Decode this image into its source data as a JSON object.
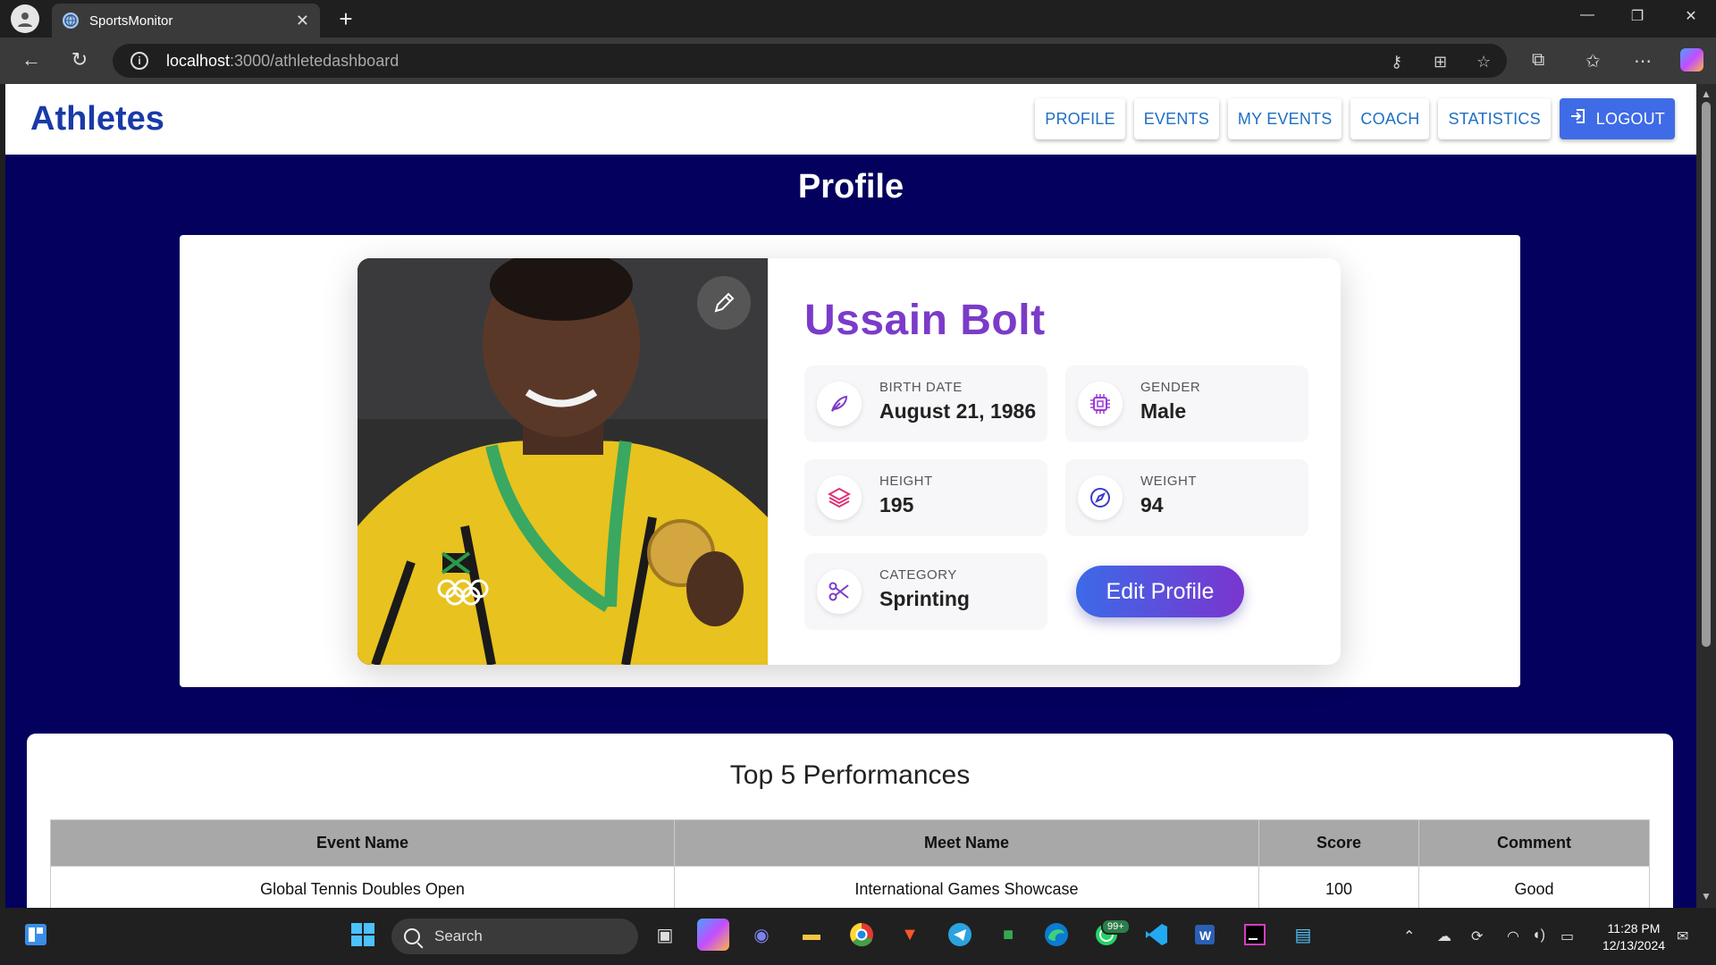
{
  "browser": {
    "tab_title": "SportsMonitor",
    "url_host": "localhost",
    "url_path": ":3000/athletedashboard"
  },
  "header": {
    "brand": "Athletes",
    "nav": [
      "PROFILE",
      "EVENTS",
      "MY EVENTS",
      "COACH",
      "STATISTICS"
    ],
    "logout": "LOGOUT"
  },
  "page": {
    "title": "Profile"
  },
  "profile": {
    "name": "Ussain Bolt",
    "birth_date_label": "BIRTH DATE",
    "birth_date": "August 21, 1986",
    "gender_label": "GENDER",
    "gender": "Male",
    "height_label": "HEIGHT",
    "height": "195",
    "weight_label": "WEIGHT",
    "weight": "94",
    "category_label": "CATEGORY",
    "category": "Sprinting",
    "edit_button": "Edit Profile",
    "icons": {
      "birth_date": "feather-icon",
      "gender": "chip-icon",
      "height": "layers-icon",
      "weight": "compass-icon",
      "category": "scissors-icon",
      "edit_photo": "pencil-icon"
    }
  },
  "performances": {
    "title": "Top 5 Performances",
    "columns": [
      "Event Name",
      "Meet Name",
      "Score",
      "Comment"
    ],
    "rows": [
      [
        "Global Tennis Doubles Open",
        "International Games Showcase",
        "100",
        "Good"
      ]
    ]
  },
  "taskbar": {
    "search_placeholder": "Search",
    "time": "11:28 PM",
    "date": "12/13/2024",
    "whatsapp_badge": "99+"
  },
  "colors": {
    "page_bg": "#04005e",
    "brand": "#1a3aa8",
    "name": "#7b3bc9",
    "logout_bg": "#3f6be6",
    "nav_text": "#1f6fc4"
  }
}
